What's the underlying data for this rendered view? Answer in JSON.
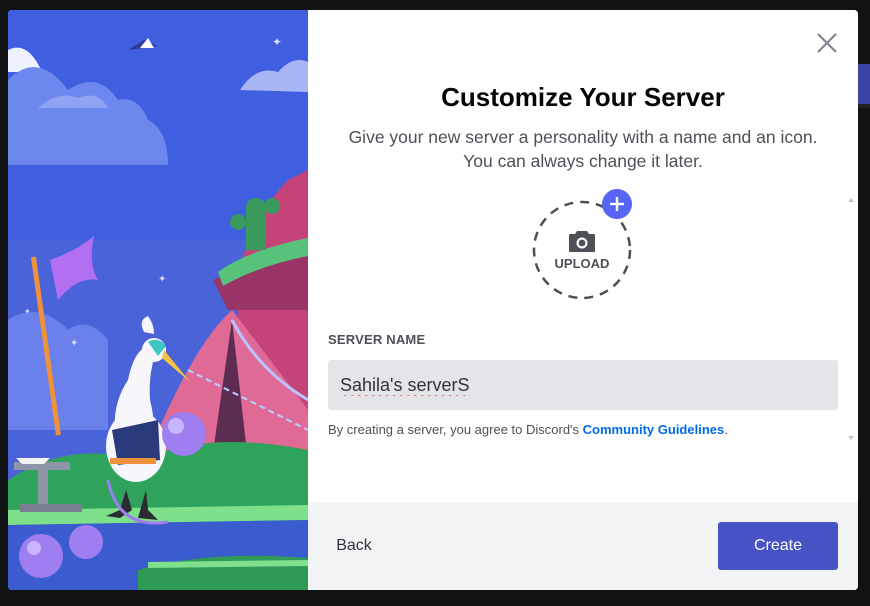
{
  "modal": {
    "title": "Customize Your Server",
    "subtitle": "Give your new server a personality with a name and an icon. You can always change it later."
  },
  "upload": {
    "label": "UPLOAD",
    "icon": "camera-icon",
    "badge_icon": "plus-icon"
  },
  "server_name": {
    "label": "SERVER NAME",
    "value": "Sahila's serverS"
  },
  "terms": {
    "prefix": "By creating a server, you agree to Discord's ",
    "link": "Community Guidelines",
    "suffix": "."
  },
  "footer": {
    "back_label": "Back",
    "create_label": "Create"
  },
  "icons": {
    "close": "close-icon"
  },
  "colors": {
    "brand": "#5865f2",
    "create_button": "#4752c4",
    "link": "#006ce7",
    "footer_bg": "#f2f3f5",
    "input_bg": "#e3e5e8",
    "art_sky": "#3f5fe0"
  }
}
